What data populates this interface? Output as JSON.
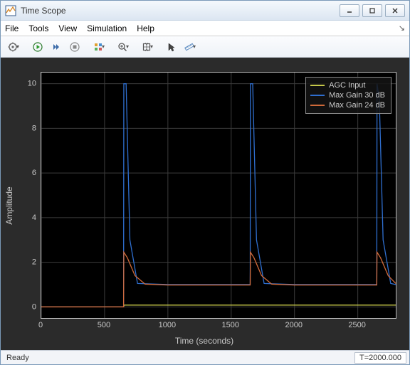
{
  "window": {
    "title": "Time Scope"
  },
  "menu": {
    "file": "File",
    "tools": "Tools",
    "view": "View",
    "simulation": "Simulation",
    "help": "Help"
  },
  "status": {
    "left": "Ready",
    "right": "T=2000.000"
  },
  "chart_data": {
    "type": "line",
    "xlabel": "Time (seconds)",
    "ylabel": "Amplitude",
    "xlim": [
      0,
      2800
    ],
    "ylim": [
      -0.5,
      10.5
    ],
    "xticks": [
      0,
      500,
      1000,
      1500,
      2000,
      2500
    ],
    "yticks": [
      0,
      2,
      4,
      6,
      8,
      10
    ],
    "series": [
      {
        "name": "AGC Input",
        "color": "#c6c84a",
        "x": [
          0,
          650,
          655,
          1000,
          1650,
          1655,
          2000,
          2650,
          2655,
          2800
        ],
        "y": [
          0,
          0,
          0.08,
          0.08,
          0.08,
          0.08,
          0.08,
          0.08,
          0.08,
          0.08
        ]
      },
      {
        "name": "Max Gain 30 dB",
        "color": "#2f6fd0",
        "x": [
          0,
          650,
          652,
          670,
          700,
          760,
          1000,
          1650,
          1652,
          1670,
          1700,
          1760,
          2000,
          2650,
          2652,
          2670,
          2700,
          2760,
          2800
        ],
        "y": [
          0,
          0,
          10,
          10,
          3,
          1.05,
          1.0,
          1.0,
          10,
          10,
          3,
          1.05,
          1.0,
          1.0,
          10,
          9.3,
          3,
          1.05,
          1.0
        ]
      },
      {
        "name": "Max Gain 24 dB",
        "color": "#d06a3a",
        "x": [
          0,
          650,
          652,
          680,
          740,
          820,
          1000,
          1650,
          1652,
          1680,
          1740,
          1820,
          2000,
          2650,
          2652,
          2680,
          2740,
          2800
        ],
        "y": [
          0,
          0,
          2.45,
          2.2,
          1.4,
          1.02,
          0.98,
          0.98,
          2.45,
          2.2,
          1.4,
          1.02,
          0.98,
          0.98,
          2.45,
          2.2,
          1.4,
          1.05
        ]
      }
    ],
    "legend_position": "top-right"
  }
}
